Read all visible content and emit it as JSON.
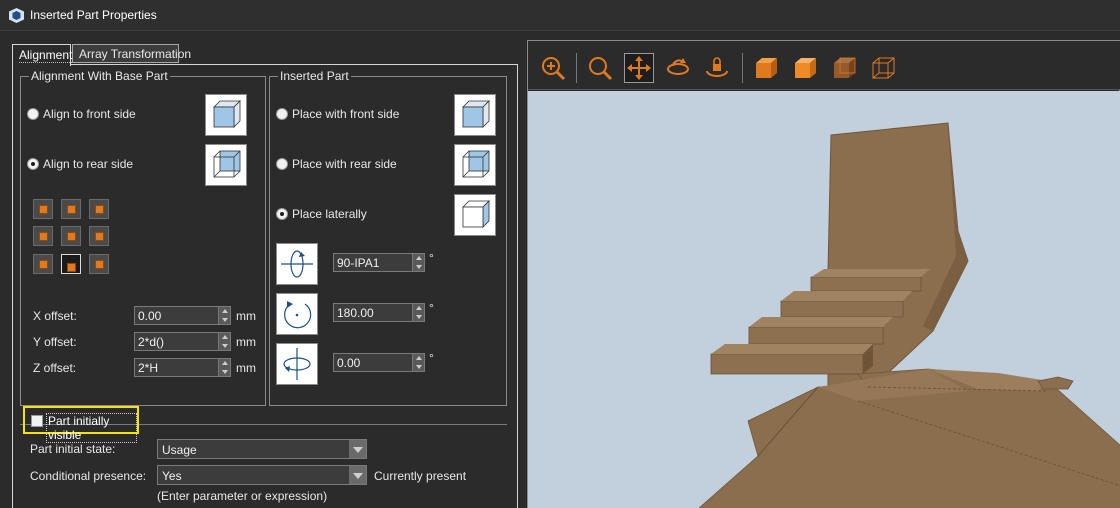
{
  "window": {
    "title": "Inserted Part Properties"
  },
  "tabs": [
    {
      "label": "Alignment",
      "active": true
    },
    {
      "label": "Array Transformation",
      "active": false
    }
  ],
  "alignment_base": {
    "group_title": "Alignment With Base Part",
    "options": [
      {
        "label": "Align to front side",
        "checked": false
      },
      {
        "label": "Align to rear side",
        "checked": true
      }
    ],
    "grid_selected": "row3-col2"
  },
  "inserted_part": {
    "group_title": "Inserted Part",
    "options": [
      {
        "label": "Place with front side",
        "checked": false
      },
      {
        "label": "Place with rear side",
        "checked": false
      },
      {
        "label": "Place laterally",
        "checked": true
      }
    ],
    "rotations": [
      {
        "value": "90-IPA1",
        "unit": "°"
      },
      {
        "value": "180.00",
        "unit": "°"
      },
      {
        "value": "0.00",
        "unit": "°"
      }
    ]
  },
  "offsets": [
    {
      "label": "X offset:",
      "value": "0.00",
      "unit": "mm"
    },
    {
      "label": "Y offset:",
      "value": "2*d()",
      "unit": "mm"
    },
    {
      "label": "Z offset:",
      "value": "2*H",
      "unit": "mm"
    }
  ],
  "visibility": {
    "label": "Part initially visible",
    "checked": false
  },
  "initial_state": {
    "label": "Part initial state:",
    "value": "Usage"
  },
  "conditional_presence": {
    "label": "Conditional presence:",
    "value": "Yes",
    "status": "Currently present",
    "hint": "(Enter parameter or expression)"
  },
  "viewer_toolbar": {
    "buttons": [
      "zoom-in-icon",
      "zoom-icon",
      "pan-icon",
      "rotate-icon",
      "orbit-lock-icon",
      "solid-cube-icon",
      "shaded-cube-icon",
      "transparent-cube-icon",
      "wireframe-cube-icon"
    ],
    "accent_color": "#e07a1f"
  },
  "colors": {
    "background": "#2b2b2b",
    "viewer_background": "#c2cfdc",
    "model": "#8b6e4e",
    "highlight": "#f5e50a"
  }
}
